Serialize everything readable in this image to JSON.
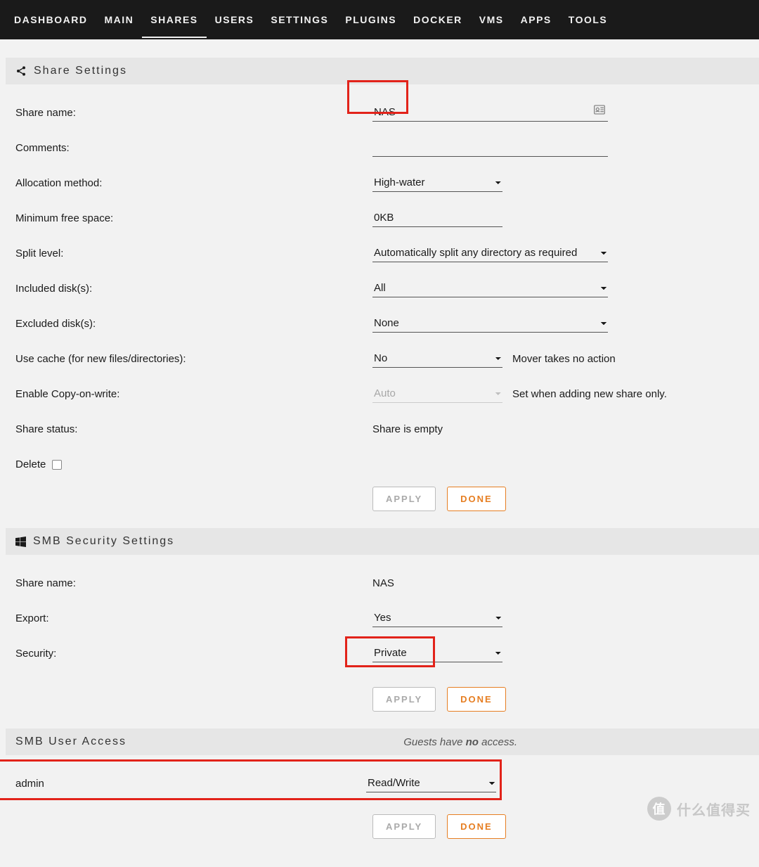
{
  "nav": {
    "items": [
      {
        "label": "DASHBOARD",
        "active": false
      },
      {
        "label": "MAIN",
        "active": false
      },
      {
        "label": "SHARES",
        "active": true
      },
      {
        "label": "USERS",
        "active": false
      },
      {
        "label": "SETTINGS",
        "active": false
      },
      {
        "label": "PLUGINS",
        "active": false
      },
      {
        "label": "DOCKER",
        "active": false
      },
      {
        "label": "VMS",
        "active": false
      },
      {
        "label": "APPS",
        "active": false
      },
      {
        "label": "TOOLS",
        "active": false
      }
    ]
  },
  "sections": {
    "share_settings_title": "Share Settings",
    "smb_security_title": "SMB Security Settings",
    "smb_user_access_title": "SMB User Access",
    "smb_user_access_hint_prefix": "Guests have ",
    "smb_user_access_hint_bold": "no",
    "smb_user_access_hint_suffix": " access."
  },
  "share": {
    "name_label": "Share name:",
    "name_value": "NAS",
    "comments_label": "Comments:",
    "comments_value": "",
    "allocation_label": "Allocation method:",
    "allocation_value": "High-water",
    "minfree_label": "Minimum free space:",
    "minfree_value": "0KB",
    "split_label": "Split level:",
    "split_value": "Automatically split any directory as required",
    "included_label": "Included disk(s):",
    "included_value": "All",
    "excluded_label": "Excluded disk(s):",
    "excluded_value": "None",
    "cache_label": "Use cache (for new files/directories):",
    "cache_value": "No",
    "cache_help": "Mover takes no action",
    "cow_label": "Enable Copy-on-write:",
    "cow_value": "Auto",
    "cow_help": "Set when adding new share only.",
    "status_label": "Share status:",
    "status_value": "Share is empty",
    "delete_label": "Delete"
  },
  "smb": {
    "name_label": "Share name:",
    "name_value": "NAS",
    "export_label": "Export:",
    "export_value": "Yes",
    "security_label": "Security:",
    "security_value": "Private"
  },
  "user_access": {
    "user_label": "admin",
    "perm_value": "Read/Write"
  },
  "buttons": {
    "apply": "Apply",
    "done": "Done"
  },
  "watermark": {
    "badge": "值",
    "text": "什么值得买"
  }
}
